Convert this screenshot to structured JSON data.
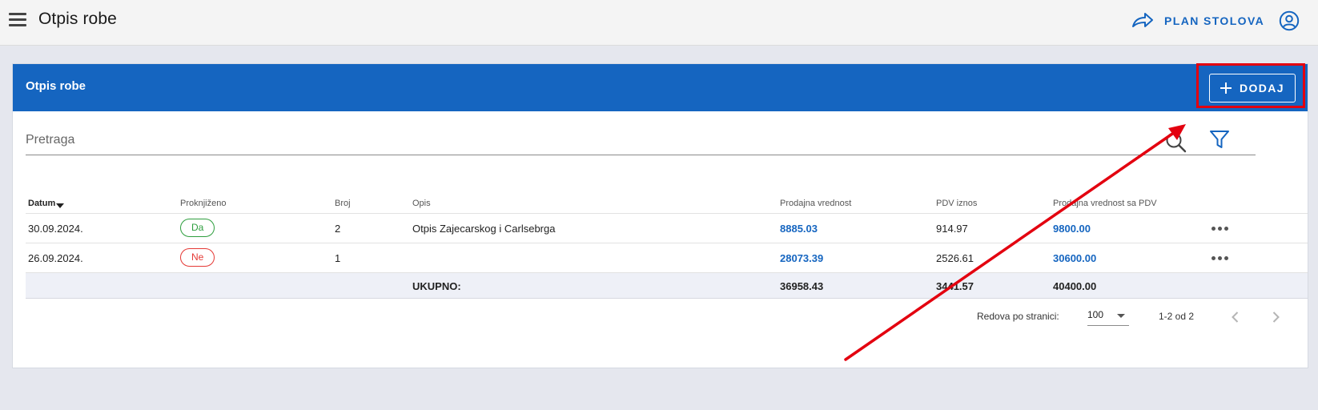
{
  "topbar": {
    "title": "Otpis robe",
    "plan_label": "PLAN STOLOVA",
    "icons": {
      "menu": "hamburger-menu-icon",
      "plan": "share-arrow-icon",
      "user": "account-circle-icon"
    }
  },
  "card": {
    "title": "Otpis robe",
    "add_label": "DODAJ",
    "search": {
      "placeholder": "Pretraga",
      "value": ""
    }
  },
  "table": {
    "columns": [
      "Datum",
      "Proknjiženo",
      "Broj",
      "Opis",
      "Prodajna vrednost",
      "PDV iznos",
      "Prodajna vrednost sa PDV"
    ],
    "sort_column": "Datum",
    "rows": [
      {
        "datum": "30.09.2024.",
        "proknjizeno": "Da",
        "broj": "2",
        "opis": "Otpis Zajecarskog i Carlsebrga",
        "prodajna": "8885.03",
        "pdv": "914.97",
        "sa_pdv": "9800.00"
      },
      {
        "datum": "26.09.2024.",
        "proknjizeno": "Ne",
        "broj": "1",
        "opis": "",
        "prodajna": "28073.39",
        "pdv": "2526.61",
        "sa_pdv": "30600.00"
      }
    ],
    "total": {
      "label": "UKUPNO:",
      "prodajna": "36958.43",
      "pdv": "3441.57",
      "sa_pdv": "40400.00"
    }
  },
  "pagination": {
    "rows_per_page_label": "Redova po stranici:",
    "rows_per_page": "100",
    "range": "1-2 od 2"
  },
  "colors": {
    "accent": "#1565c0",
    "status_yes": "#2e9e3e",
    "status_no": "#e53935",
    "annotation": "#e3000f"
  }
}
